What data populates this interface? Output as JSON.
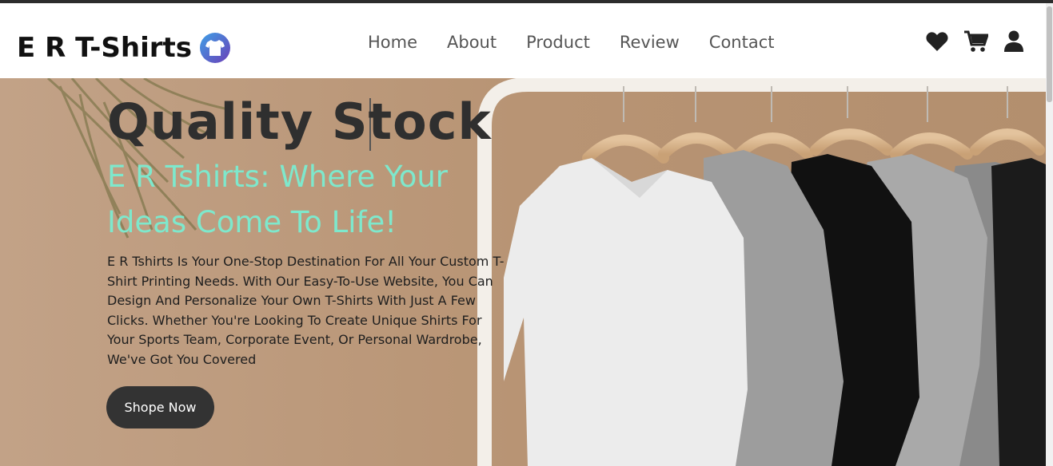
{
  "brand": {
    "name": "E R T-Shirts",
    "badge_icon": "tshirt-icon"
  },
  "nav": {
    "items": [
      {
        "label": "Home"
      },
      {
        "label": "About"
      },
      {
        "label": "Product"
      },
      {
        "label": "Review"
      },
      {
        "label": "Contact"
      }
    ]
  },
  "header_icons": [
    "heart-icon",
    "cart-icon",
    "user-icon"
  ],
  "hero": {
    "title": "Quality Stock",
    "subtitle": "E R Tshirts: Where Your Ideas Come To Life!",
    "description": "E R Tshirts Is Your One-Stop Destination For All Your Custom T-Shirt Printing Needs. With Our Easy-To-Use Website, You Can Design And Personalize Your Own T-Shirts With Just A Few Clicks. Whether You're Looking To Create Unique Shirts For Your Sports Team, Corporate Event, Or Personal Wardrobe, We've Got You Covered",
    "cta_label": "Shope Now"
  },
  "colors": {
    "accent_subtitle": "#7ee8cc",
    "cta_bg": "#333333",
    "hero_bg": "#bd9a7c",
    "logo_badge": "#3ea0e6"
  }
}
